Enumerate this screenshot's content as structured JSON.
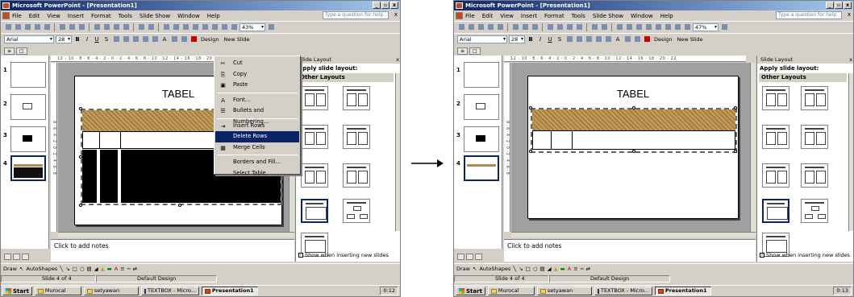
{
  "window": {
    "title": "Microsoft PowerPoint - [Presentation1]",
    "controls": [
      "_",
      "▫",
      "x"
    ]
  },
  "menu": {
    "items": [
      "File",
      "Edit",
      "View",
      "Insert",
      "Format",
      "Tools",
      "Slide Show",
      "Window",
      "Help"
    ],
    "help_placeholder": "Type a question for help",
    "close": "x"
  },
  "toolbar": {
    "zoom_left": "43%",
    "zoom_right": "47%",
    "font": "Arial",
    "size": "28",
    "bold": "B",
    "italic": "I",
    "underline": "U",
    "shadow": "S",
    "font_size_up": "A",
    "design": "Design",
    "new_slide": "New Slide"
  },
  "outline_tabs": {
    "outline": "≡",
    "slides": "□"
  },
  "thumbs": {
    "numbers": [
      "1",
      "2",
      "3",
      "4"
    ]
  },
  "ruler": {
    "top": "12 · 10 · 8 · 6 · 4 · 2 · 0 · 2 · 4 · 6 · 8 · 10 · 12 · 14 · 16 · 18 · 20 · 22",
    "left": "8 · 6 · 4 · 2 · 0 · 2 · 4 · 6 · 8"
  },
  "slide": {
    "title": "TABEL"
  },
  "notes": {
    "placeholder": "Click to add notes"
  },
  "task_pane": {
    "title": "Slide Layout",
    "apply": "Apply slide layout:",
    "other_layouts": "Other Layouts",
    "show_when": "Show when inserting new slides",
    "checkmark": "✓"
  },
  "context_menu": {
    "items": [
      {
        "icon": "✂",
        "label": "Cut"
      },
      {
        "icon": "⎘",
        "label": "Copy"
      },
      {
        "icon": "▣",
        "label": "Paste"
      },
      {
        "icon": "A",
        "label": "Font..."
      },
      {
        "icon": "☰",
        "label": "Bullets and Numbering..."
      },
      {
        "icon": "⇥",
        "label": "Insert Rows"
      },
      {
        "icon": "",
        "label": "Delete Rows"
      },
      {
        "icon": "▦",
        "label": "Merge Cells"
      },
      {
        "icon": "",
        "label": "Borders and Fill..."
      },
      {
        "icon": "",
        "label": "Select Table"
      }
    ]
  },
  "drawing": {
    "draw": "Draw",
    "autoshapes": "AutoShapes"
  },
  "status": {
    "slide": "Slide 4 of 4",
    "design": "Default Design"
  },
  "taskbar": {
    "start": "Start",
    "items": [
      "Murocal",
      "setyawan",
      "TEXTBOX - Micro...",
      "Presentation1"
    ],
    "clock_left": "0:12",
    "clock_right": "0:13"
  },
  "colors": {
    "title_bar": "#0a246a",
    "highlight": "#0a246a",
    "table_row": "#b08a4a"
  }
}
